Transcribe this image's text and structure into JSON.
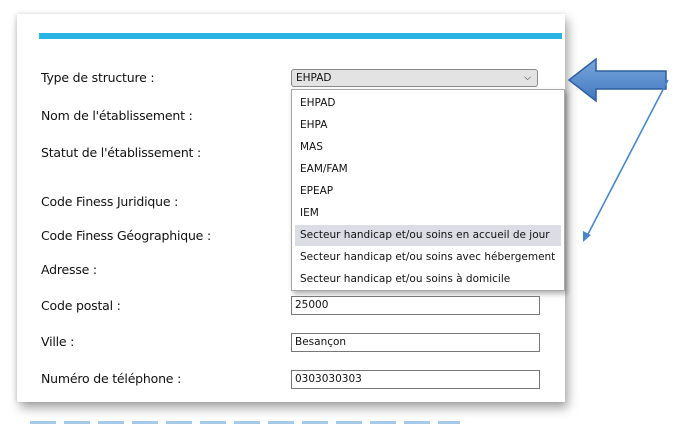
{
  "form": {
    "accent_color": "#28b5e5",
    "fields": {
      "type_structure": {
        "label": "Type de structure :",
        "value": "EHPAD"
      },
      "nom_etablissement": {
        "label": "Nom de l'établissement :"
      },
      "statut_etablissement": {
        "label": "Statut de l'établissement :"
      },
      "finess_juridique": {
        "label": "Code Finess Juridique :"
      },
      "finess_geographique": {
        "label": "Code Finess Géographique :"
      },
      "adresse": {
        "label": "Adresse :"
      },
      "code_postal": {
        "label": "Code postal :",
        "value": "25000"
      },
      "ville": {
        "label": "Ville :",
        "value": "Besançon"
      },
      "telephone": {
        "label": "Numéro de téléphone :",
        "value": "0303030303"
      }
    }
  },
  "dropdown": {
    "highlighted_option": "Secteur handicap et/ou soins en accueil de jour",
    "options": [
      "EHPAD",
      "EHPA",
      "MAS",
      "EAM/FAM",
      "EPEAP",
      "IEM",
      "Secteur handicap et/ou soins en accueil de jour",
      "Secteur handicap et/ou soins avec hébergement",
      "Secteur handicap et/ou soins à domicile"
    ]
  },
  "annotations": {
    "arrow_color": "#4a86c8",
    "icons": [
      "big-left-arrow-icon",
      "pointer-line-arrow-icon"
    ]
  }
}
